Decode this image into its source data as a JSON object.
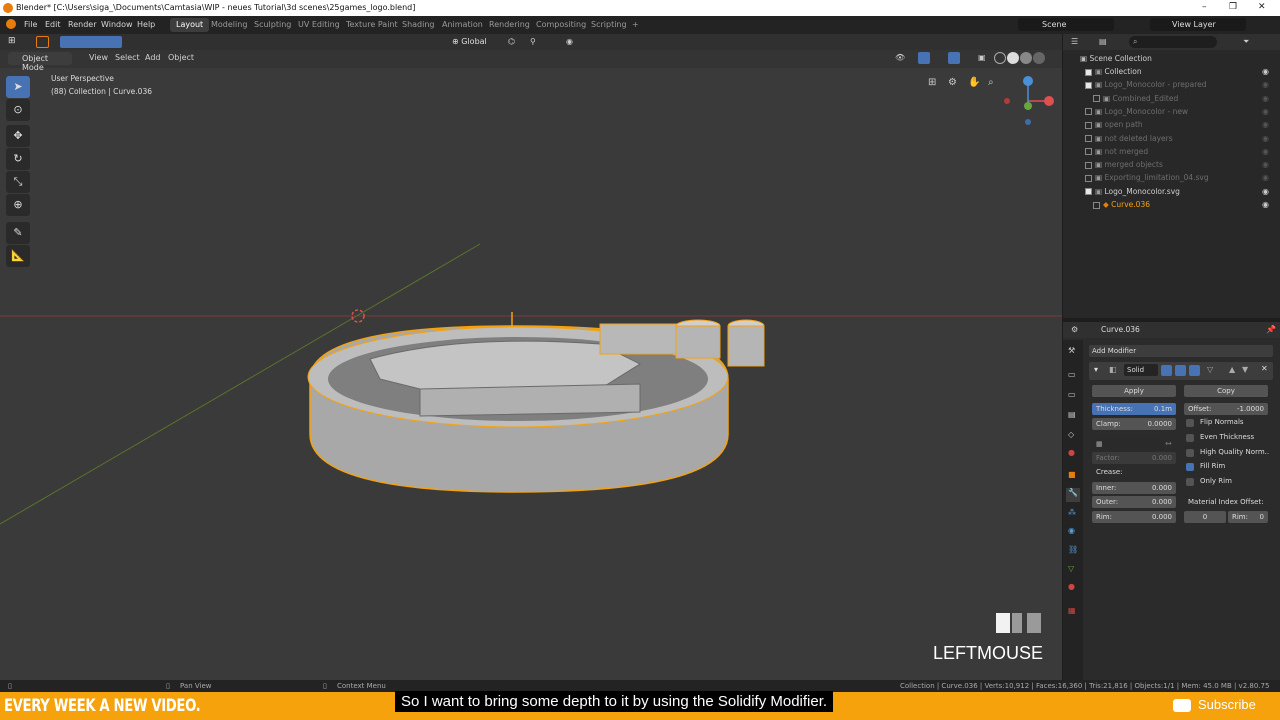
{
  "window": {
    "title": "Blender* [C:\\Users\\siga_\\Documents\\Camtasia\\WIP - neues Tutorial\\3d scenes\\25games_logo.blend]",
    "controls": [
      "–",
      "❐",
      "✕"
    ]
  },
  "menu": [
    "File",
    "Edit",
    "Render",
    "Window",
    "Help"
  ],
  "workspaces": [
    "Layout",
    "Modeling",
    "Sculpting",
    "UV Editing",
    "Texture Paint",
    "Shading",
    "Animation",
    "Rendering",
    "Compositing",
    "Scripting",
    "+"
  ],
  "active_workspace": "Layout",
  "scene": {
    "scene_name": "Scene",
    "view_layer": "View Layer"
  },
  "viewport": {
    "orientation": "Global",
    "mode": "Object Mode",
    "header_menus": [
      "View",
      "Select",
      "Add",
      "Object"
    ],
    "perspective_label": "User Perspective",
    "collection_label": "(88) Collection | Curve.036",
    "tools": [
      "select-box",
      "cursor",
      "move",
      "rotate",
      "scale",
      "transform",
      "annotate",
      "measure"
    ]
  },
  "outliner": {
    "root": "Scene Collection",
    "rows": [
      {
        "label": "Collection",
        "checked": true,
        "dim": false,
        "indent": 1
      },
      {
        "label": "Logo_Monocolor - prepared",
        "checked": true,
        "dim": true,
        "indent": 1
      },
      {
        "label": "Combined_Edited",
        "checked": false,
        "dim": true,
        "indent": 2
      },
      {
        "label": "Logo_Monocolor - new",
        "checked": false,
        "dim": true,
        "indent": 1
      },
      {
        "label": "open path",
        "checked": false,
        "dim": true,
        "indent": 1
      },
      {
        "label": "not deleted layers",
        "checked": false,
        "dim": true,
        "indent": 1
      },
      {
        "label": "not merged",
        "checked": false,
        "dim": true,
        "indent": 1
      },
      {
        "label": "merged objects",
        "checked": false,
        "dim": true,
        "indent": 1
      },
      {
        "label": "Exporting_limitation_04.svg",
        "checked": false,
        "dim": true,
        "indent": 1
      },
      {
        "label": "Logo_Monocolor.svg",
        "checked": true,
        "dim": false,
        "indent": 1
      },
      {
        "label": "Curve.036",
        "checked": false,
        "dim": false,
        "indent": 2,
        "highlight": true
      }
    ]
  },
  "properties": {
    "object_name": "Curve.036",
    "add_modifier": "Add Modifier",
    "modifier_name": "Solid",
    "apply": "Apply",
    "copy": "Copy",
    "thickness_label": "Thickness:",
    "thickness_value": "0.1m",
    "offset_label": "Offset:",
    "offset_value": "-1.0000",
    "clamp_label": "Clamp:",
    "clamp_value": "0.0000",
    "factor_label": "Factor:",
    "factor_value": "0.000",
    "crease_label": "Crease:",
    "inner_label": "Inner:",
    "inner_value": "0.000",
    "outer_label": "Outer:",
    "outer_value": "0.000",
    "rim_label": "Rim:",
    "rim_value": "0.000",
    "material_offset_label": "Material Index Offset:",
    "mat_value": "0",
    "mat_rim_label": "Rim:",
    "mat_rim_value": "0",
    "checkboxes": [
      {
        "label": "Flip Normals",
        "checked": false
      },
      {
        "label": "Even Thickness",
        "checked": false
      },
      {
        "label": "High Quality Norm..",
        "checked": false
      },
      {
        "label": "Fill Rim",
        "checked": true
      },
      {
        "label": "Only Rim",
        "checked": false
      }
    ]
  },
  "statusbar": {
    "left": "Pan View",
    "middle": "Context Menu",
    "right": "Collection | Curve.036 | Verts:10,912 | Faces:16,360 | Tris:21,816 | Objects:1/1 | Mem: 45.0 MB | v2.80.75"
  },
  "overlay": {
    "banner": "EVERY WEEK A NEW VIDEO.",
    "subtitle": "So I want to bring some depth to it by using the Solidify Modifier.",
    "subscribe": "Subscribe",
    "key_hint": "LEFTMOUSE"
  },
  "colors": {
    "accent": "#4772b3",
    "selection": "#f5a20d",
    "banner": "#f5a20d"
  }
}
